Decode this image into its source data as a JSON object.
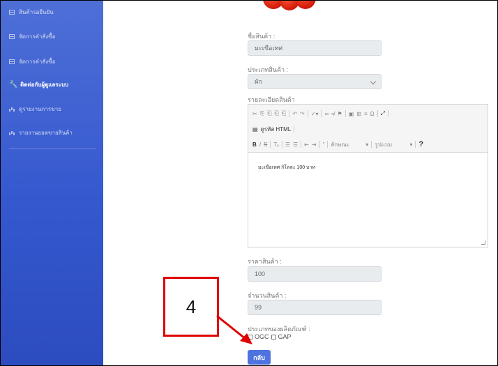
{
  "sidebar": {
    "items": [
      {
        "label": "สินค้ารอยืนยัน",
        "icon": "grid-icon"
      },
      {
        "label": "จัดการคำสั่งซื้อ",
        "icon": "grid-icon"
      },
      {
        "label": "จัดการคำสั่งซื้อ",
        "icon": "grid-icon"
      },
      {
        "label": "ติดต่อกับผู้ดูแลระบบ",
        "icon": "wrench-icon"
      },
      {
        "label": "ดูรายงานการขาย",
        "icon": "chart-icon"
      },
      {
        "label": "รายงานยอดขายสินค้า",
        "icon": "chart-icon"
      }
    ]
  },
  "form": {
    "name_label": "ชื่อสินค้า :",
    "name_value": "มะเขือเทศ",
    "type_label": "ประเภทสินค้า :",
    "type_value": "ผัก",
    "detail_label": "รายละเอียดสินค้า",
    "editor_source_label": "ดูรหัส HTML",
    "editor_format_placeholder": "ลักษณะ",
    "editor_size_placeholder": "รูปแบบ",
    "editor_content": "มะเขือเทศ กิโลละ 100 บาท",
    "price_label": "ราคาสินค้า :",
    "price_value": "100",
    "qty_label": "จำนวนสินค้า :",
    "qty_value": "99",
    "product_type_label": "ประเภทของผลิตภัณฑ์ :",
    "check_ogc": "OGC",
    "check_gap": "GAP",
    "back_button": "กลับ"
  },
  "annotation": {
    "number": "4",
    "color": "#e00000"
  },
  "colors": {
    "sidebar": "#4e6fd6",
    "primary": "#4e73df"
  }
}
